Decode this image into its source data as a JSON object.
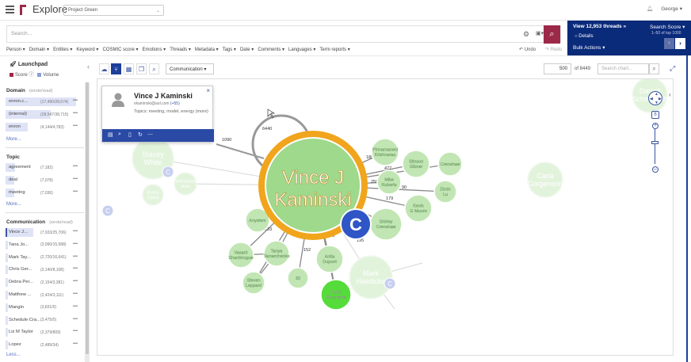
{
  "app": {
    "title": "Explore",
    "project": "Project Green",
    "user": "George"
  },
  "search": {
    "placeholder": "Search..."
  },
  "results": {
    "threads": "View 12,953 threads »",
    "details": "Details",
    "bulk": "Bulk Actions ▾",
    "score": "Search Score ▾",
    "range": "1–50 of top 1000"
  },
  "filters": [
    "Person ▾",
    "Domain ▾",
    "Entities ▾",
    "Keyword ▾",
    "COSMIC score ▾",
    "Emotions ▾",
    "Threads ▾",
    "Metadata ▾",
    "Tags ▾",
    "Date ▾",
    "Comments ▾",
    "Languages ▾",
    "Term reports ▾"
  ],
  "history": {
    "undo": "Undo",
    "redo": "Redo"
  },
  "launchpad": {
    "title": "Launchpad",
    "score": "Score",
    "volume": "Volume"
  },
  "sidebar": {
    "domain": {
      "title": "Domain",
      "sub": "(wrote/read)",
      "more": "More...",
      "rows": [
        {
          "label": "enron.c...",
          "count": "(17,490/28,674)",
          "fill": 0.9
        },
        {
          "label": "(internal)",
          "count": "(28,547/38,715)",
          "fill": 0.58
        },
        {
          "label": "enron",
          "count": "(4,144/4,783)",
          "fill": 0.28
        }
      ]
    },
    "topic": {
      "title": "Topic",
      "more": "More...",
      "rows": [
        {
          "label": "agreement",
          "count": "(7,182)",
          "fill": 0.12
        },
        {
          "label": "deal",
          "count": "(7,078)",
          "fill": 0.11
        },
        {
          "label": "meeting",
          "count": "(7,036)",
          "fill": 0.11
        }
      ]
    },
    "communication": {
      "title": "Communication",
      "sub": "(wrote/read)",
      "less": "Less...",
      "rows": [
        {
          "label": "Vince J...",
          "count": "(7,933/25,706)",
          "fill": 0.35
        },
        {
          "label": "Tana Jo...",
          "count": "(3,990/15,588)",
          "fill": 0.03
        },
        {
          "label": "Mark Tay...",
          "count": "(2,720/16,641)",
          "fill": 0.03
        },
        {
          "label": "Chris Ger...",
          "count": "(3,140/8,108)",
          "fill": 0.03
        },
        {
          "label": "Debra Per...",
          "count": "(2,154/3,381)",
          "fill": 0.03
        },
        {
          "label": "Matthew ...",
          "count": "(2,424/3,111)",
          "fill": 0.03
        },
        {
          "label": "Mangin",
          "count": "(3,831/0)",
          "fill": 0.03
        },
        {
          "label": "Schedule Cra...",
          "count": "(3,475/0)",
          "fill": 0.03
        },
        {
          "label": "Liz M Taylor",
          "count": "(2,379/809)",
          "fill": 0.03
        },
        {
          "label": "Lopez",
          "count": "(2,489/34)",
          "fill": 0.03
        }
      ]
    }
  },
  "chart_toolbar": {
    "mode": "Communication",
    "limit": "500",
    "of": "of 8449",
    "search_placeholder": "Search chart..."
  },
  "popup": {
    "name": "Vince J Kaminski",
    "email": "vkaminski@aol.com",
    "email_extra": "(+55)",
    "topics": "Topics:  meeting, model, energy (more)"
  },
  "graph": {
    "center": "Vince J Kaminski",
    "badge": "C",
    "nodes": [
      {
        "label": "Pinnamaneni Krishnarao",
        "fade": false
      },
      {
        "label": "Stinson Gibner",
        "fade": false
      },
      {
        "label": "Crenshaw",
        "fade": false
      },
      {
        "label": "Mike Roberts",
        "fade": false
      },
      {
        "label": "Zimin Lu",
        "fade": false
      },
      {
        "label": "Kevin G Moore",
        "fade": false
      },
      {
        "label": "Shirley Crenshaw",
        "fade": false
      },
      {
        "label": "Anita Dupont",
        "fade": false
      },
      {
        "label": "David Ricafrente",
        "fade": false
      },
      {
        "label": "32",
        "fade": false
      },
      {
        "label": "Tanya Tamarchenko",
        "fade": false
      },
      {
        "label": "Vasant Shanbhogue",
        "fade": false
      },
      {
        "label": "Steven Leppard",
        "fade": false
      },
      {
        "label": "Anystem",
        "fade": false
      },
      {
        "label": "Stacey White",
        "fade": true
      },
      {
        "label": "Evans Casey",
        "fade": true
      },
      {
        "label": "Pinkertonetle John",
        "fade": true
      },
      {
        "label": "Mark Haedicke",
        "fade": true
      },
      {
        "label": "Carla Gorgenson",
        "fade": true
      },
      {
        "label": "Darrell Schoolcraft",
        "fade": true
      }
    ],
    "edges": [
      "6440",
      "1090",
      "185",
      "477",
      "566",
      "255",
      "90",
      "179",
      "167",
      "233",
      "167",
      "152",
      "266",
      "195"
    ]
  }
}
